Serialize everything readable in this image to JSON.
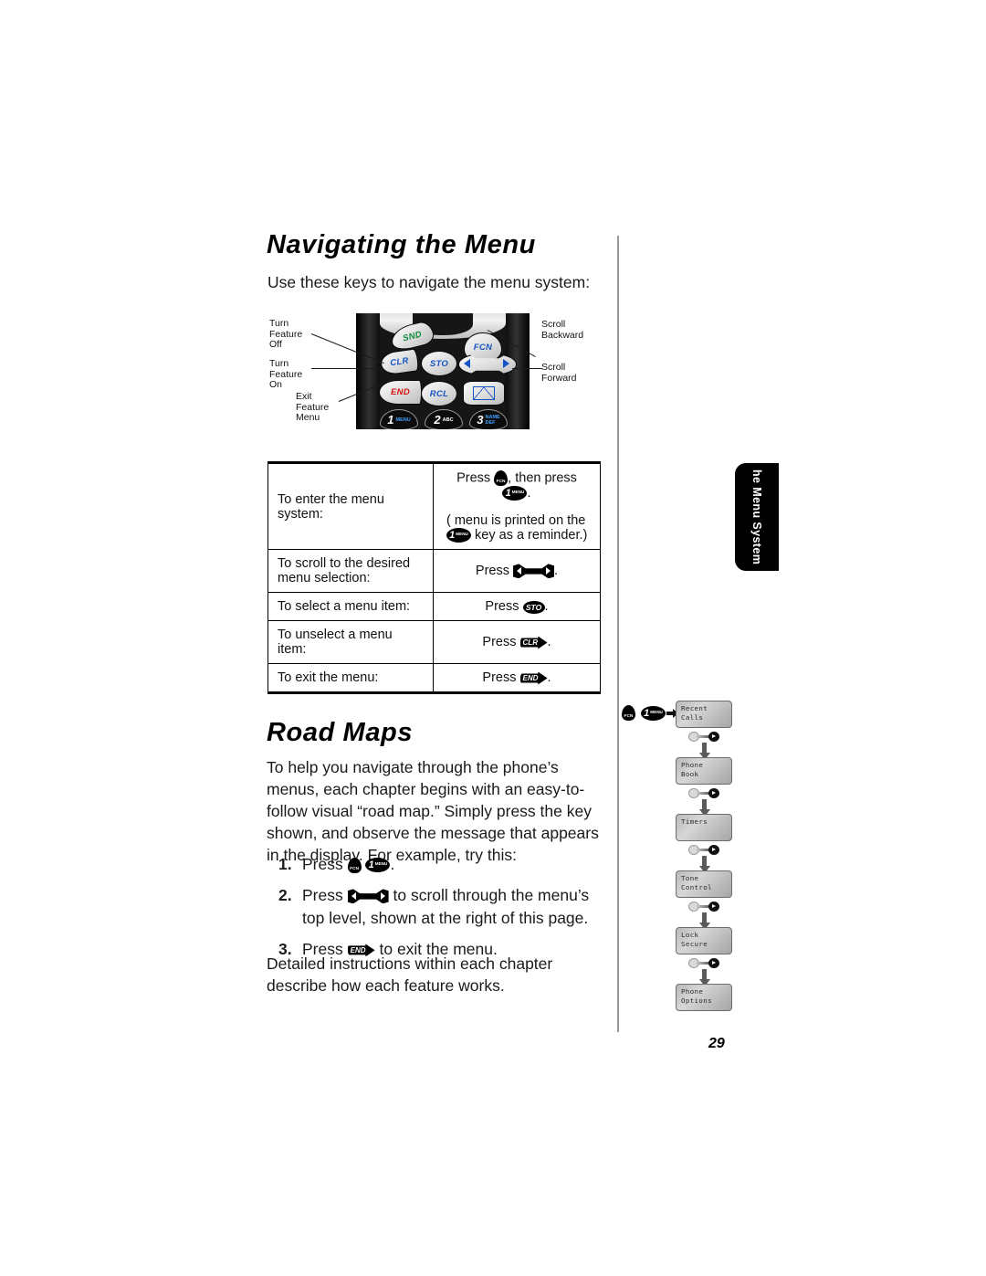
{
  "document": {
    "page_number": "29",
    "thumb_tab": "he Menu System"
  },
  "sections": {
    "navigating": {
      "heading": "Navigating the Menu",
      "intro": "Use these keys to navigate the menu system:"
    },
    "road_maps": {
      "heading": "Road Maps",
      "paragraph": "To help you navigate through the phone’s menus, each chapter begins with an easy-to-follow visual “road map.” Simply press the key shown, and observe the message that appears in the display. For example, try this:",
      "closing": "Detailed instructions within each chapter describe how each feature works."
    }
  },
  "phone_figure": {
    "callouts": {
      "turn_feature_off": "Turn\nFeature\nOff",
      "turn_feature_on": "Turn\nFeature\nOn",
      "exit_feature_menu": "Exit\nFeature\nMenu",
      "scroll_backward": "Scroll\nBackward",
      "scroll_forward": "Scroll\nForward"
    },
    "keys": {
      "snd": "SND",
      "fcn": "FCN",
      "clr": "CLR",
      "sto": "STO",
      "rcl": "RCL",
      "end": "END",
      "message": "envelope-icon"
    },
    "numeric_keys": [
      {
        "digit": "1",
        "label": "MENU"
      },
      {
        "digit": "2",
        "label": "ABC"
      },
      {
        "digit": "3",
        "label": "NAME",
        "label2": "DEF"
      }
    ],
    "colors": {
      "snd_green": "#0f8a3e",
      "key_blue": "#1554c4",
      "end_red": "#d2100f"
    }
  },
  "key_table": {
    "rows": [
      {
        "action": "To enter the menu system:",
        "instruction_pre": "Press",
        "instruction_mid": ", then press",
        "instruction_end": ".",
        "note_pre": "( menu  is printed on the",
        "note_end": "key as a reminder.)"
      },
      {
        "action": "To scroll to the desired menu selection:",
        "instruction_pre": "Press",
        "instruction_end": "."
      },
      {
        "action": "To select a menu item:",
        "instruction_pre": "Press",
        "instruction_end": ".",
        "key": "STO"
      },
      {
        "action": "To  unselect  a menu item:",
        "instruction_pre": "Press",
        "instruction_end": ".",
        "key": "CLR"
      },
      {
        "action": "To exit the menu:",
        "instruction_pre": "Press",
        "instruction_end": ".",
        "key": "END"
      }
    ]
  },
  "steps": [
    {
      "num": "1.",
      "pre": "Press",
      "mid": "",
      "post": "."
    },
    {
      "num": "2.",
      "pre": "Press",
      "post": "to scroll through the menu’s top level, shown at the right of this page."
    },
    {
      "num": "3.",
      "pre": "Press",
      "post": "to exit the menu."
    }
  ],
  "flowchart": {
    "start_keys": [
      "FCN",
      "1 MENU"
    ],
    "boxes": [
      {
        "line1": "Recent",
        "line2": "Calls"
      },
      {
        "line1": "Phone",
        "line2": "Book"
      },
      {
        "line1": "Timers",
        "line2": ""
      },
      {
        "line1": "Tone",
        "line2": "Control"
      },
      {
        "line1": "Lock",
        "line2": "Secure"
      },
      {
        "line1": "Phone",
        "line2": "Options"
      }
    ]
  },
  "inline_keys": {
    "fcn": "FCN",
    "one_digit": "1",
    "one_label": "MENU",
    "sto": "STO",
    "clr": "CLR",
    "end": "END"
  }
}
